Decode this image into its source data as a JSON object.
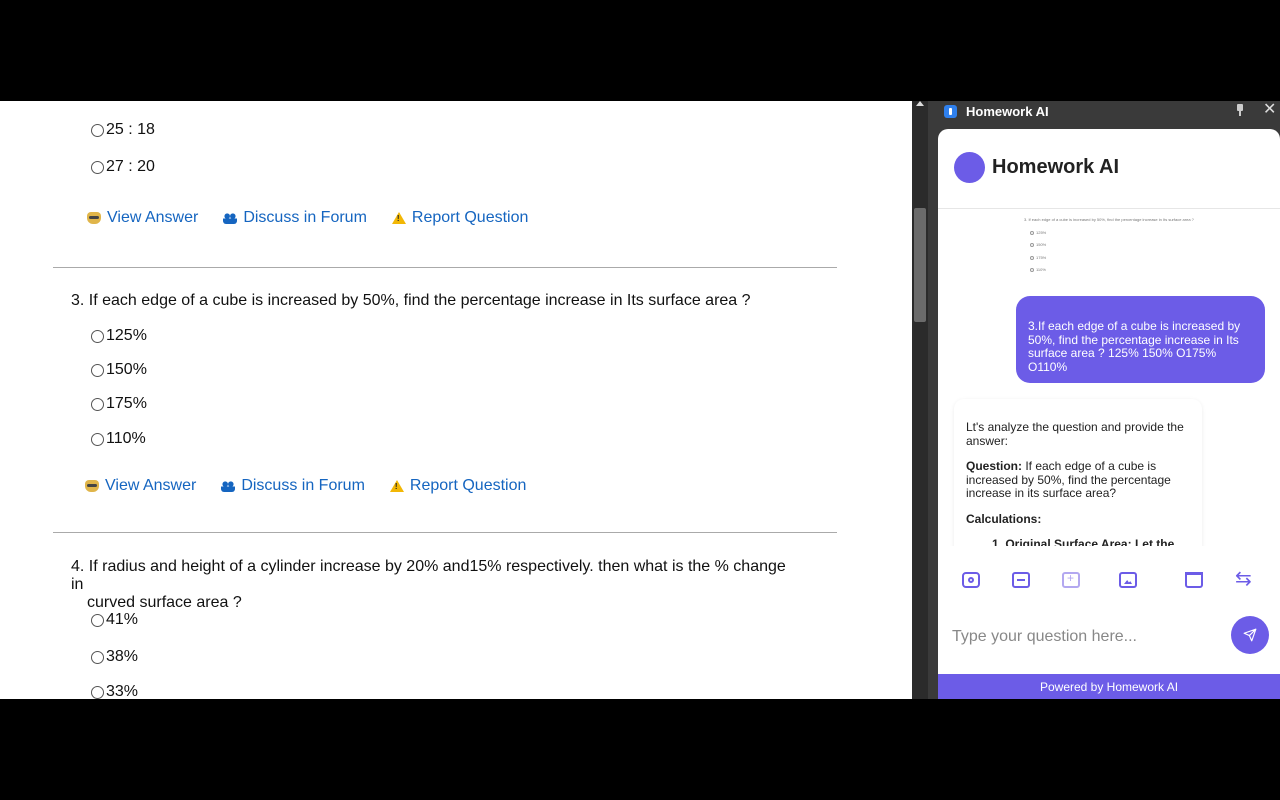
{
  "quiz": {
    "q2_options": [
      "25 : 18",
      "27 : 20"
    ],
    "actions": {
      "view_answer": "View Answer",
      "discuss": "Discuss in Forum",
      "report": "Report Question"
    },
    "q3": {
      "text": "3. If each edge of a cube is increased by 50%, find the percentage increase in Its surface area ?",
      "options": [
        "125%",
        "150%",
        "175%",
        "110%"
      ]
    },
    "q4": {
      "text_line1": "4. If radius and height of a cylinder increase by 20% and15% respectively. then what is the % change in",
      "text_line2": "curved surface area ?",
      "options": [
        "41%",
        "38%",
        "33%"
      ]
    }
  },
  "panel": {
    "window_title": "Homework AI",
    "header_title": "Homework AI",
    "screenshot_preview": {
      "question": "3. If each edge of a cube is increased by 50%, find the percentage increase in Its surface area ?",
      "options": [
        "125%",
        "150%",
        "175%",
        "110%"
      ]
    },
    "user_message": "3.If each edge of a cube is increased by 50%, find the percentage increase in Its surface area ? 125% 150% O175% O110%",
    "bot_message": {
      "intro": "Lt's analyze the question and provide the answer:",
      "question_label": "Question:",
      "question_text": " If each edge of a cube is increased by 50%, find the percentage increase in its surface area?",
      "calculations_label": "Calculations:",
      "first_item": "1. Original Surface Area: Let the"
    },
    "input_placeholder": "Type your question here...",
    "footer": "Powered by Homework AI"
  }
}
